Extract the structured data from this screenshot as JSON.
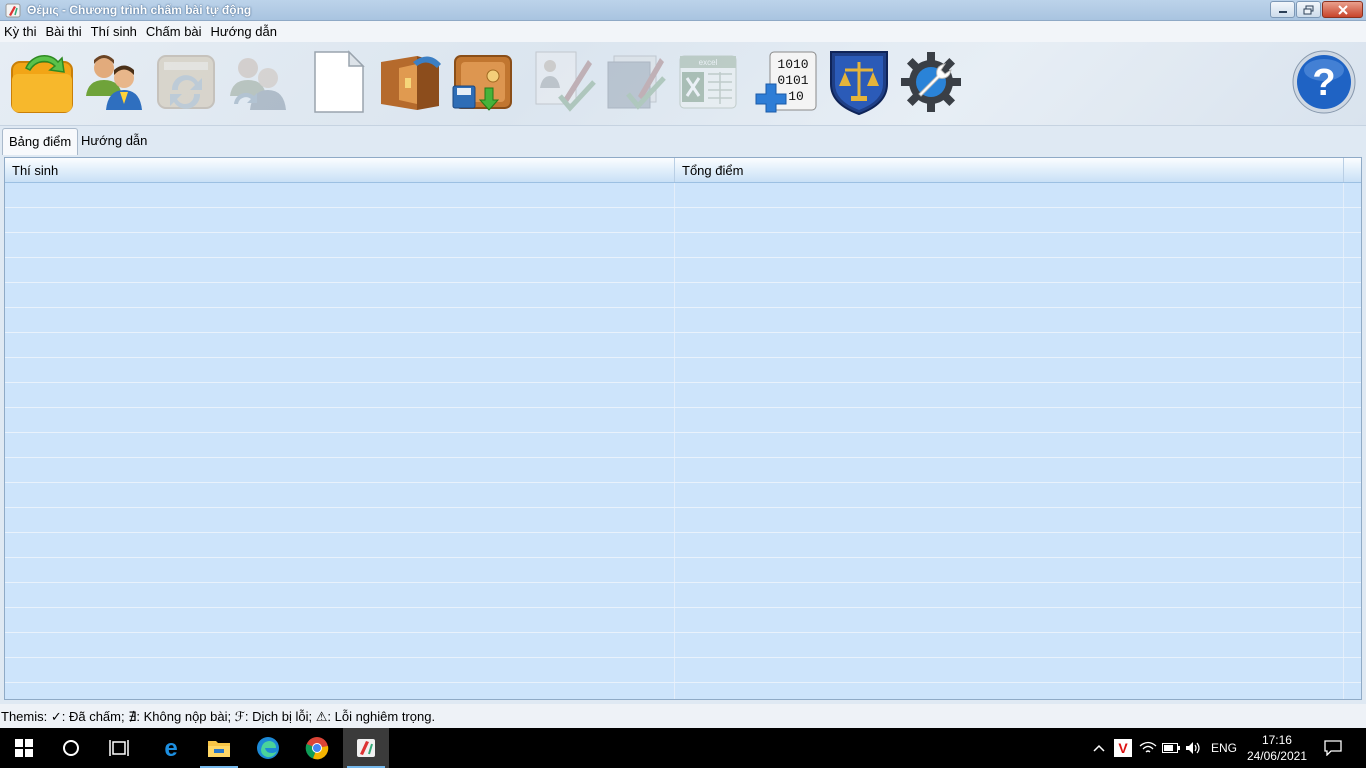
{
  "window": {
    "title": "Θέμις - Chương trình chấm bài tự động"
  },
  "menu": {
    "items": [
      {
        "label": "Kỳ thi"
      },
      {
        "label": "Bài thi"
      },
      {
        "label": "Thí sinh"
      },
      {
        "label": "Chấm bài"
      },
      {
        "label": "Hướng dẫn"
      }
    ]
  },
  "toolbar": {
    "buttons": [
      {
        "icon": "open-folder-icon",
        "enabled": true
      },
      {
        "icon": "users-icon",
        "enabled": true
      },
      {
        "icon": "refresh-tasks-icon",
        "enabled": false
      },
      {
        "icon": "refresh-users-icon",
        "enabled": false
      },
      {
        "icon": "new-document-icon",
        "enabled": true
      },
      {
        "icon": "safe-open-icon",
        "enabled": true
      },
      {
        "icon": "safe-save-icon",
        "enabled": true
      },
      {
        "icon": "grade-contestant-icon",
        "enabled": false
      },
      {
        "icon": "grade-all-icon",
        "enabled": false
      },
      {
        "label": "excel",
        "icon": "excel-export-icon",
        "enabled": false
      },
      {
        "label": "1010 0101 10",
        "icon": "binary-data-icon",
        "enabled": true
      },
      {
        "icon": "scales-of-justice-icon",
        "enabled": true
      },
      {
        "icon": "settings-gear-icon",
        "enabled": true
      },
      {
        "icon": "help-icon",
        "enabled": true
      }
    ]
  },
  "tabs": [
    {
      "label": "Bảng điểm",
      "active": true
    },
    {
      "label": "Hướng dẫn",
      "active": false
    }
  ],
  "table": {
    "columns": [
      "Thí sinh",
      "Tổng điểm"
    ],
    "rows": []
  },
  "status": {
    "text": "Themis: ✓: Đã chấm; ∄: Không nộp bài; ℱ: Dịch bị lỗi; ⚠: Lỗi nghiêm trọng."
  },
  "taskbar": {
    "language": "ENG",
    "time": "17:16",
    "date": "24/06/2021"
  }
}
